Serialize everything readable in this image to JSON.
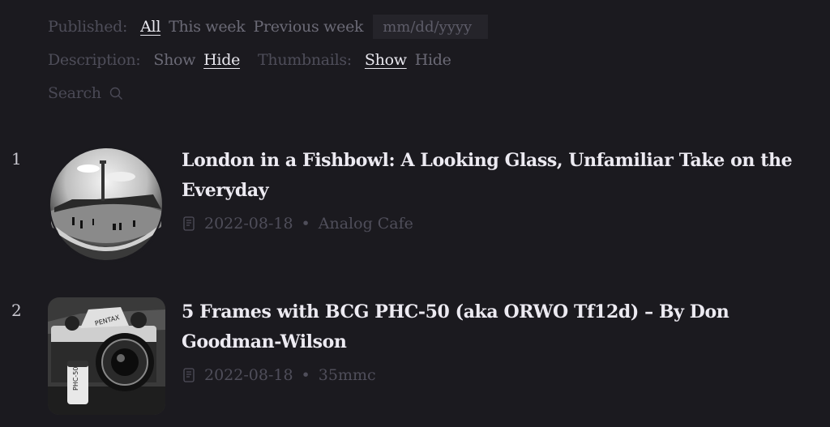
{
  "filters": {
    "published": {
      "label": "Published:",
      "options": [
        {
          "label": "All",
          "active": true
        },
        {
          "label": "This week",
          "active": false
        },
        {
          "label": "Previous week",
          "active": false
        }
      ],
      "date_placeholder": "mm/dd/yyyy"
    },
    "description": {
      "label": "Description:",
      "options": [
        {
          "label": "Show",
          "active": false
        },
        {
          "label": "Hide",
          "active": true
        }
      ]
    },
    "thumbnails": {
      "label": "Thumbnails:",
      "options": [
        {
          "label": "Show",
          "active": true
        },
        {
          "label": "Hide",
          "active": false
        }
      ]
    },
    "search": {
      "label": "Search",
      "icon": "search-icon"
    }
  },
  "articles": [
    {
      "rank": "1",
      "title": "London in a Fishbowl: A Looking Glass, Unfamiliar Take on the Everyday",
      "date": "2022-08-18",
      "source": "Analog Cafe",
      "icon": "document-icon",
      "thumbnail": "fisheye black-and-white photo of a city square with a column"
    },
    {
      "rank": "2",
      "title": "5 Frames with BCG PHC-50 (aka ORWO Tf12d) – By Don Goodman-Wilson",
      "date": "2022-08-18",
      "source": "35mmc",
      "icon": "document-icon",
      "thumbnail": "black-and-white photo of a Pentax camera with a PHC-50 film canister"
    }
  ],
  "meta_separator": "•"
}
